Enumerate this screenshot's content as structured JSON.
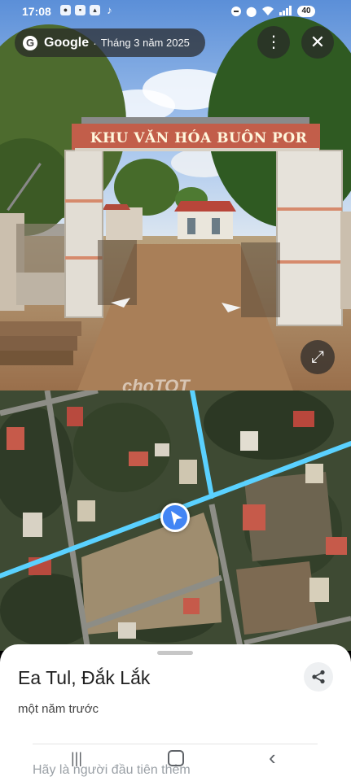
{
  "status_bar": {
    "time": "17:08",
    "notification_icons": [
      "app-icon",
      "message-icon",
      "gallery-icon",
      "tiktok-icon"
    ],
    "system_icons": [
      "do-not-disturb-icon",
      "location-icon",
      "wifi-icon",
      "signal-icon"
    ],
    "battery": "40"
  },
  "header": {
    "logo_letter": "G",
    "app_name": "Google",
    "separator": "·",
    "date": "Tháng 3 năm 2025",
    "more_glyph": "⋮",
    "close_glyph": "✕"
  },
  "street_view": {
    "gate_sign": "KHU VĂN HÓA BUÔN POR",
    "watermark": "choTOT",
    "expand_glyph": "⤢"
  },
  "bottom_sheet": {
    "place": "Ea Tul, Đắk Lắk",
    "time_ago": "một năm trước",
    "first_to_add": "Hãy là người đầu tiên thêm"
  },
  "nav_bar": {
    "recent_glyph": "|||",
    "back_glyph": "‹"
  },
  "colors": {
    "map_route": "#5ad1ff",
    "location_dot": "#4285f4",
    "sheet_bg": "#ffffff"
  }
}
